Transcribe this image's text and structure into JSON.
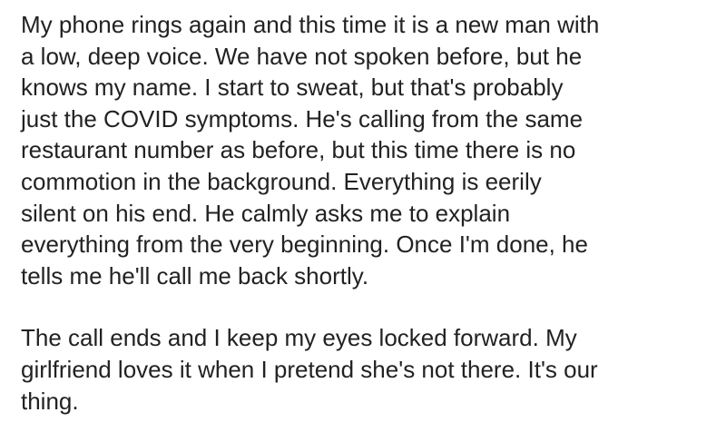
{
  "post": {
    "paragraphs": [
      "My phone rings again and this time it is a new man with\na low, deep voice. We have not spoken before, but he\nknows my name. I start to sweat, but that's probably\njust the COVID symptoms. He's calling from the same\nrestaurant number as before, but this time there is no\ncommotion in the background. Everything is eerily\nsilent on his end. He calmly asks me to explain\neverything from the very beginning. Once I'm done, he\ntells me he'll call me back shortly.",
      "The call ends and I keep my eyes locked forward. My\ngirlfriend loves it when I pretend she's not there. It's our\nthing."
    ]
  }
}
